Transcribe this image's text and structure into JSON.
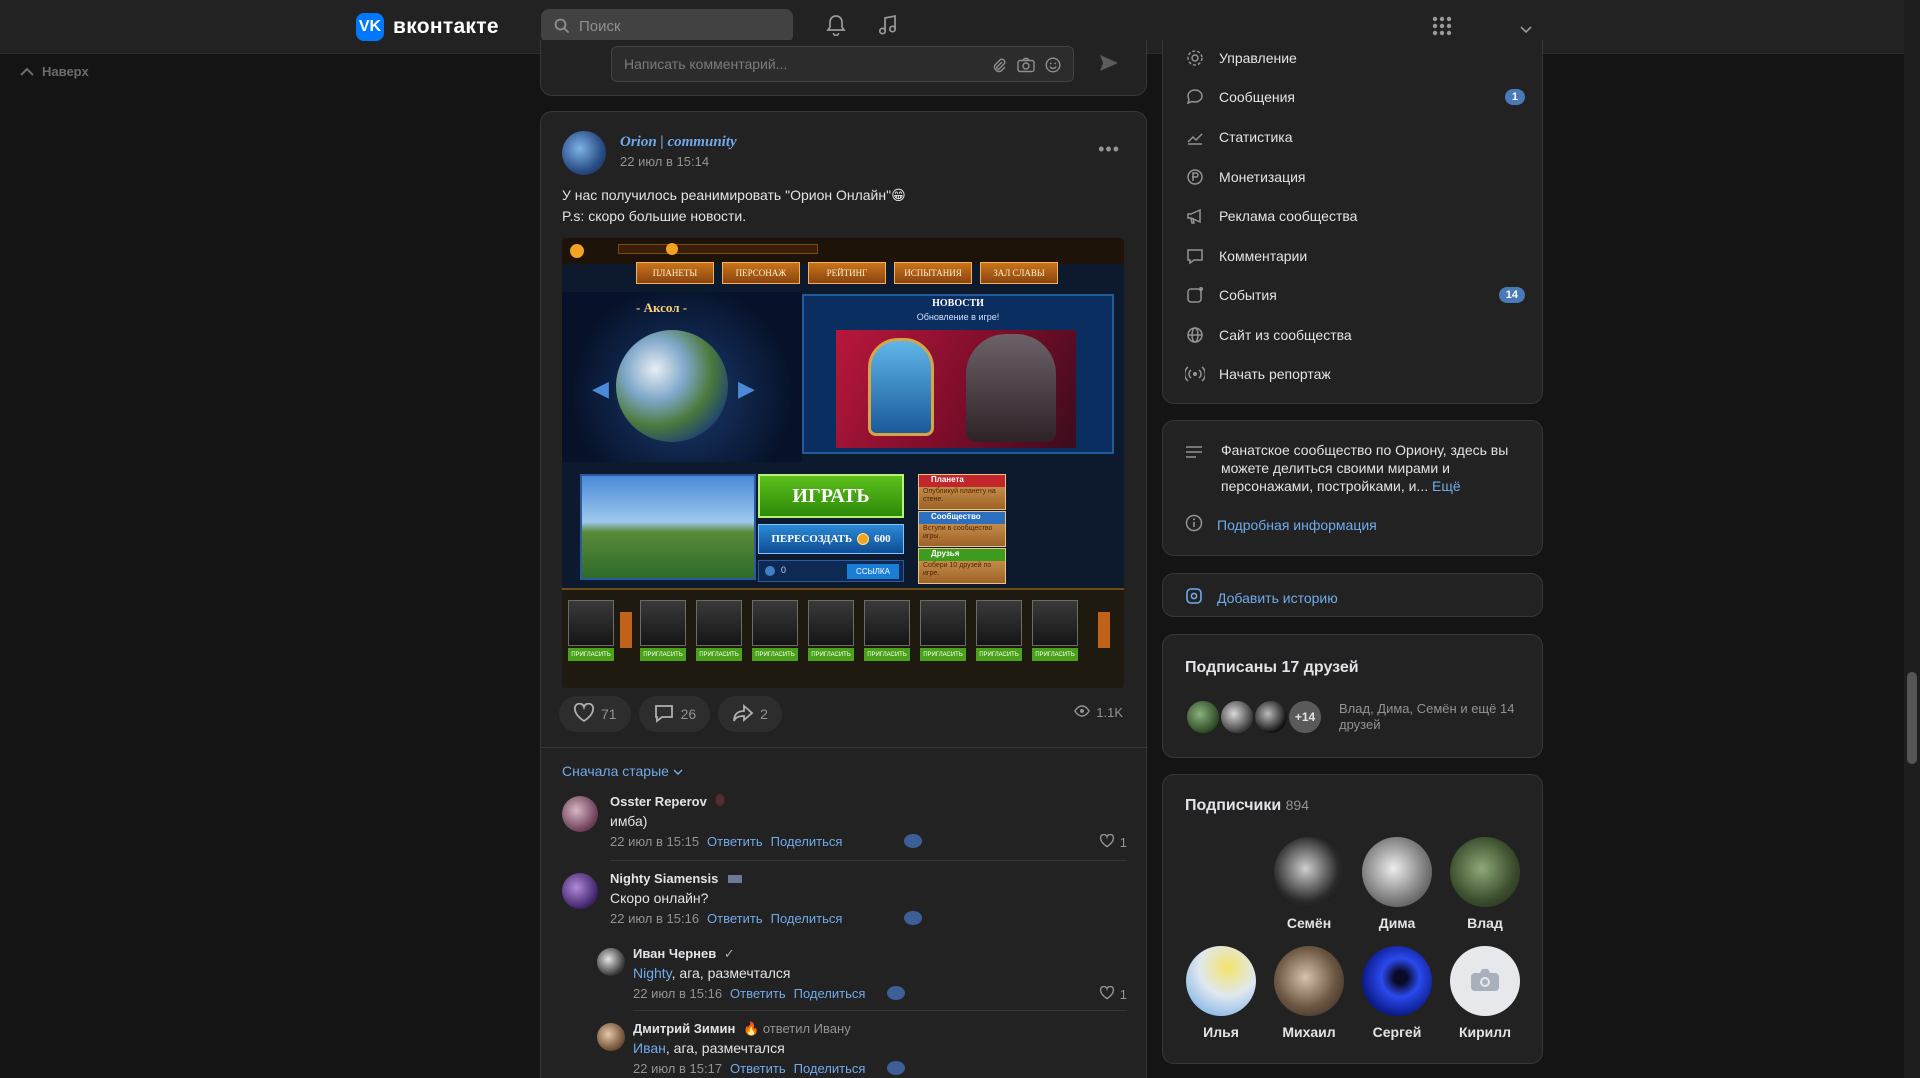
{
  "header": {
    "brand": "вконтакте",
    "logo_glyph": "VK",
    "search_placeholder": "Поиск"
  },
  "back_to_top": "Наверх",
  "comment_box": {
    "placeholder": "Написать комментарий..."
  },
  "post": {
    "author": "Orion | community",
    "date": "22 июл в 15:14",
    "text_line1": "У нас получилось реанимировать \"Орион Онлайн\"😁",
    "text_line2": "P.s: скоро большие новости.",
    "menu": "•••",
    "image": {
      "tabs": [
        "ПЛАНЕТЫ",
        "ПЕРСОНАЖ",
        "РЕЙТИНГ",
        "ИСПЫТАНИЯ",
        "ЗАЛ СЛАВЫ"
      ],
      "planet_name": "- Аксол -",
      "news_title": "НОВОСТИ",
      "news_subtitle": "Обновление в игре!",
      "play": "ИГРАТЬ",
      "recreate": "ПЕРЕСОЗДАТЬ",
      "recreate_cost": "600",
      "ref_count": "0",
      "ref_button": "ССЫЛКА",
      "quests": [
        {
          "title": "Планета",
          "desc": "Опубликуй планету на стене."
        },
        {
          "title": "Сообщество",
          "desc": "Вступи в сообщество игры."
        },
        {
          "title": "Друзья",
          "desc": "Собери 10 друзей по игре."
        }
      ],
      "invite_label": "ПРИГЛАСИТЬ"
    },
    "likes": "71",
    "comments": "26",
    "shares": "2",
    "views": "1.1K",
    "sort_label": "Сначала старые"
  },
  "comments": [
    {
      "name": "Osster Reperov",
      "text": "имба)",
      "date": "22 июл в 15:15",
      "reply": "Ответить",
      "share": "Поделиться",
      "likes": "1"
    },
    {
      "name": "Nighty Siamensis",
      "text": "Скоро онлайн?",
      "date": "22 июл в 15:16",
      "reply": "Ответить",
      "share": "Поделиться",
      "likes": ""
    },
    {
      "name": "Иван Чернев",
      "mention": "Nighty",
      "text": ", ага, размечтался",
      "date": "22 июл в 15:16",
      "reply": "Ответить",
      "share": "Поделиться",
      "likes": "1"
    },
    {
      "name": "Дмитрий Зимин",
      "replied_to": "ответил Ивану",
      "mention": "Иван",
      "text": ", ага, размечтался",
      "date": "22 июл в 15:17",
      "reply": "Ответить",
      "share": "Поделиться",
      "likes": ""
    }
  ],
  "sidebar_menu": [
    {
      "label": "Управление",
      "icon": "gear-icon",
      "badge": ""
    },
    {
      "label": "Сообщения",
      "icon": "message-icon",
      "badge": "1"
    },
    {
      "label": "Статистика",
      "icon": "chart-icon",
      "badge": ""
    },
    {
      "label": "Монетизация",
      "icon": "coin-icon",
      "badge": ""
    },
    {
      "label": "Реклама сообщества",
      "icon": "megaphone-icon",
      "badge": ""
    },
    {
      "label": "Комментарии",
      "icon": "comment-icon",
      "badge": ""
    },
    {
      "label": "События",
      "icon": "event-icon",
      "badge": "14"
    },
    {
      "label": "Сайт из сообщества",
      "icon": "globe-icon",
      "badge": ""
    },
    {
      "label": "Начать репортаж",
      "icon": "broadcast-icon",
      "badge": ""
    }
  ],
  "about": {
    "text": "Фанатское сообщество по Ориону, здесь вы можете делиться своими мирами и персонажами, постройками, и...",
    "more": "Ещё",
    "details": "Подробная информация"
  },
  "add_story": "Добавить историю",
  "friends_following": {
    "title": "Подписаны 17 друзей",
    "extra": "+14",
    "names": "Влад, Дима, Семён и ещё 14 друзей"
  },
  "subscribers": {
    "title": "Подписчики",
    "count": "894",
    "people": [
      "Семён",
      "Дима",
      "Влад",
      "Илья",
      "Михаил",
      "Сергей",
      "Кирилл"
    ]
  }
}
